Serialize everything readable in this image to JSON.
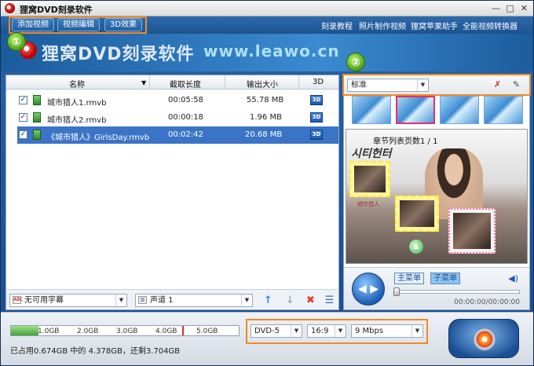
{
  "window": {
    "title": "狸窝DVD刻录软件",
    "controls": [
      "—",
      "□",
      "✕"
    ]
  },
  "toolbar": {
    "buttons": [
      "添加视频",
      "视频编辑",
      "3D效果"
    ],
    "links": [
      "刻录教程",
      "照片制作视频",
      "狸窝苹果助手",
      "全能视频转换器"
    ]
  },
  "banner": {
    "title": "狸窝DVD刻录软件",
    "url": "www.leawo.cn",
    "badge1": "①",
    "badge2": "②"
  },
  "file_table": {
    "columns": [
      "名称",
      "截取长度",
      "输出大小",
      "3D"
    ],
    "rows": [
      {
        "name": "城市猎人1.rmvb",
        "length": "00:05:58",
        "size": "55.78 MB",
        "checked": "✓",
        "three_d": "3D"
      },
      {
        "name": "城市猎人2.rmvb",
        "length": "00:00:18",
        "size": "1.96 MB",
        "checked": "✓",
        "three_d": "3D"
      },
      {
        "name": "《城市猎人》GirlsDay.rmvb",
        "length": "00:02:42",
        "size": "20.68 MB",
        "checked": "✓",
        "three_d": "3D"
      }
    ],
    "selected_index": 2
  },
  "bottom_controls": {
    "subtitle": "无可用字幕",
    "subtitle_lead": "ABC",
    "audio": "声道 1",
    "actions": [
      "↑",
      "↓",
      "✖",
      "☰"
    ]
  },
  "menu_panel": {
    "template": "标准",
    "preview_title": "章节列表页数1 / 1",
    "preview_logo": "시티헌터",
    "preview_caption": "城市猎人",
    "menu_tab": "主菜单",
    "submenu_tab": "子菜单",
    "time": "00:00:00/00:00:00",
    "nav_symbol": "◀ ▶",
    "volume_icon": "◀)"
  },
  "footer": {
    "capacity_ticks": [
      "1.0GB",
      "2.0GB",
      "3.0GB",
      "4.0GB",
      "5.0GB"
    ],
    "capacity_fill_fraction": 0.12,
    "status": "已占用0.674GB 中的 4.378GB，还剩3.704GB",
    "disc_type": "DVD-5",
    "aspect": "16:9",
    "bitrate": "9 Mbps"
  },
  "colors": {
    "highlight": "#f08a24",
    "selected_row": "#3b74c6",
    "window_blue": "#1f4e86"
  }
}
